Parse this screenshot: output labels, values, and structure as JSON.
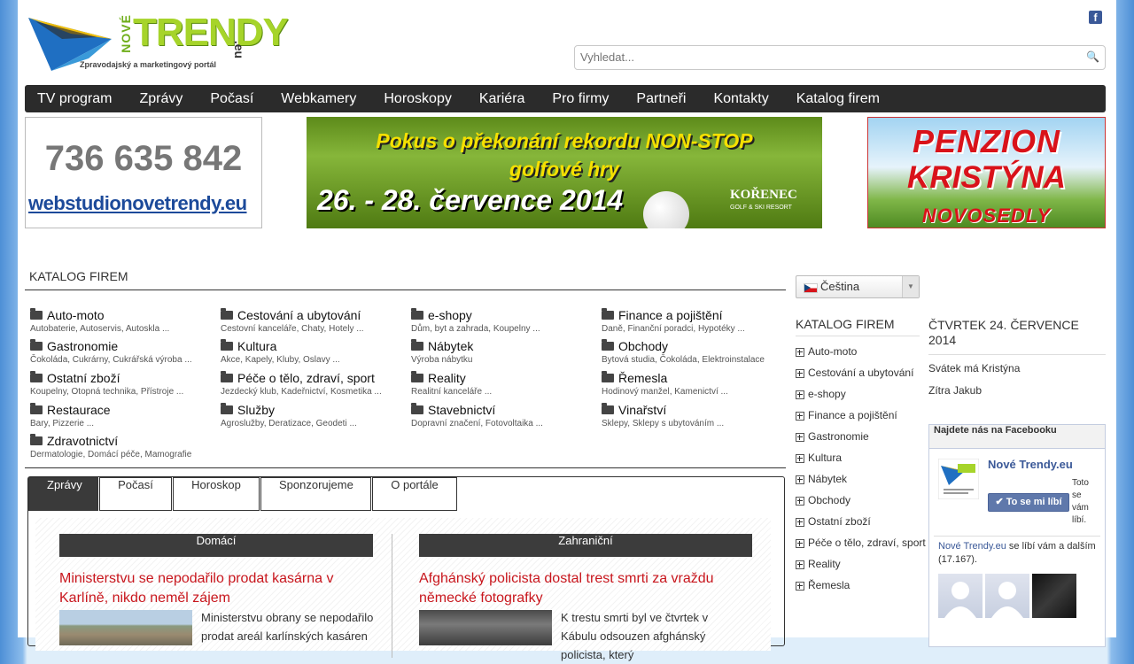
{
  "header": {
    "logo_nove": "NOVÉ",
    "logo_trendy": "TRENDY",
    "logo_eu": ".eu",
    "logo_tagline": "Zpravodajský a marketingový portál",
    "fb_icon": "f",
    "search_placeholder": "Vyhledat..."
  },
  "nav": [
    "TV program",
    "Zprávy",
    "Počasí",
    "Webkamery",
    "Horoskopy",
    "Kariéra",
    "Pro firmy",
    "Partneři",
    "Kontakty",
    "Katalog firem"
  ],
  "banners": {
    "left_phone": "736 635 842",
    "left_url": "webstudionovetrendy.eu",
    "golf_line1": "Pokus o překonání rekordu NON-STOP",
    "golf_line2": "golfové hry",
    "golf_line3": "26. - 28. července 2014",
    "golf_brand": "KOŘENEC",
    "golf_brand_sub": "GOLF & SKI RESORT",
    "penzion_l1": "PENZION",
    "penzion_l2": "KRISTÝNA",
    "penzion_l3": "NOVOSEDLY"
  },
  "catalog": {
    "title": "KATALOG FIREM",
    "items": [
      {
        "title": "Auto-moto",
        "sub": "Autobaterie, Autoservis, Autoskla ..."
      },
      {
        "title": "Cestování a ubytování",
        "sub": "Cestovní kanceláře, Chaty, Hotely ..."
      },
      {
        "title": "e-shopy",
        "sub": "Dům, byt a zahrada, Koupelny ..."
      },
      {
        "title": "Finance a pojištění",
        "sub": "Daně, Finanční poradci, Hypotéky ..."
      },
      {
        "title": "Gastronomie",
        "sub": "Čokoláda, Cukrárny, Cukrářská výroba ..."
      },
      {
        "title": "Kultura",
        "sub": "Akce, Kapely, Kluby, Oslavy ..."
      },
      {
        "title": "Nábytek",
        "sub": "Výroba nábytku"
      },
      {
        "title": "Obchody",
        "sub": "Bytová studia, Čokoláda, Elektroinstalace"
      },
      {
        "title": "Ostatní zboží",
        "sub": "Koupelny, Otopná technika, Přístroje ..."
      },
      {
        "title": "Péče o tělo, zdraví, sport",
        "sub": "Jezdecký klub, Kadeřnictví, Kosmetika ..."
      },
      {
        "title": "Reality",
        "sub": "Realitní kanceláře ..."
      },
      {
        "title": "Řemesla",
        "sub": "Hodinový manžel, Kamenictví ..."
      },
      {
        "title": "Restaurace",
        "sub": "Bary, Pizzerie ..."
      },
      {
        "title": "Služby",
        "sub": "Agroslužby, Deratizace, Geodeti ..."
      },
      {
        "title": "Stavebnictví",
        "sub": "Dopravní značení, Fotovoltaika ..."
      },
      {
        "title": "Vinařství",
        "sub": "Sklepy, Sklepy s ubytováním ..."
      },
      {
        "title": "Zdravotnictví",
        "sub": "Dermatologie, Domácí péče, Mamografie"
      }
    ]
  },
  "tabs": [
    "Zprávy",
    "Počasí",
    "Horoskop",
    "Sponzorujeme",
    "O portále"
  ],
  "news": {
    "domestic": {
      "header": "Domácí",
      "headline": "Ministerstvu se nepodařilo prodat kasárna v Karlíně, nikdo neměl zájem",
      "text": "Ministerstvu obrany se nepodařilo prodat areál karlínských kasáren"
    },
    "foreign": {
      "header": "Zahraniční",
      "headline": "Afghánský policista dostal trest smrti za vraždu německé fotografky",
      "text": "K trestu smrti byl ve čtvrtek v Kábulu odsouzen afghánský policista, který"
    }
  },
  "sidebar": {
    "language": "Čeština",
    "catalog_title": "KATALOG FIREM",
    "items": [
      "Auto-moto",
      "Cestování a ubytování",
      "e-shopy",
      "Finance a pojištění",
      "Gastronomie",
      "Kultura",
      "Nábytek",
      "Obchody",
      "Ostatní zboží",
      "Péče o tělo, zdraví, sport",
      "Reality",
      "Řemesla"
    ]
  },
  "date": {
    "day": "ČTVRTEK 24. ČERVENCE 2014",
    "nameday": "Svátek má Kristýna",
    "tomorrow": "Zítra Jakub"
  },
  "facebook": {
    "header": "Najdete nás na Facebooku",
    "page_name": "Nové Trendy.eu",
    "like_button": "To se mi líbí",
    "like_text": "Toto se vám líbí.",
    "count_page": "Nové Trendy.eu",
    "count_text": " se líbí vám a dalším (17.167)."
  }
}
